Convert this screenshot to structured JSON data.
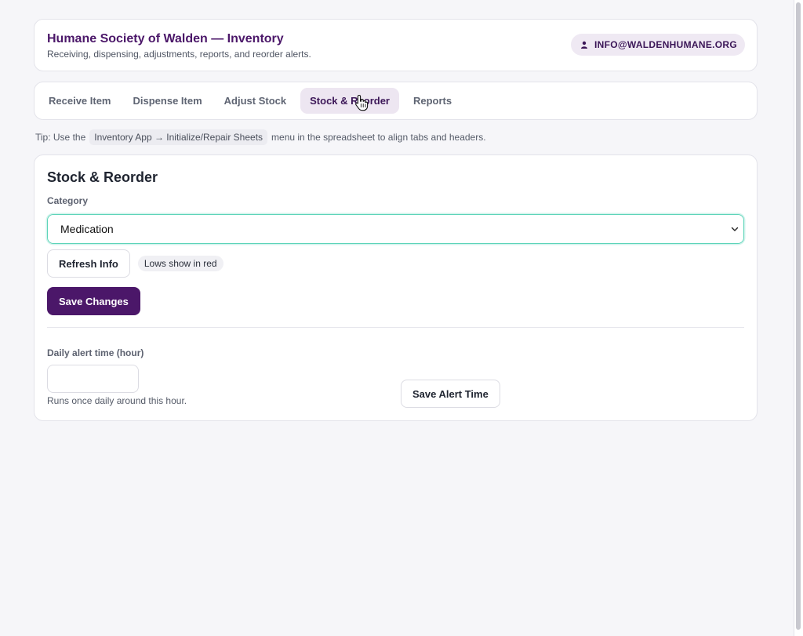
{
  "header": {
    "title": "Humane Society of Walden — Inventory",
    "subtitle": "Receiving, dispensing, adjustments, reports, and reorder alerts.",
    "user_email": "INFO@WALDENHUMANE.ORG",
    "user_icon": "user-icon"
  },
  "tabs": [
    {
      "label": "Receive Item",
      "active": false
    },
    {
      "label": "Dispense Item",
      "active": false
    },
    {
      "label": "Adjust Stock",
      "active": false
    },
    {
      "label": "Stock & Reorder",
      "active": true
    },
    {
      "label": "Reports",
      "active": false
    }
  ],
  "tip": {
    "prefix": "Tip: Use the",
    "code": "Inventory App → Initialize/Repair Sheets",
    "suffix": "menu in the spreadsheet to align tabs and headers."
  },
  "stock": {
    "title": "Stock & Reorder",
    "category_label": "Category",
    "category_value": "Medication",
    "refresh_label": "Refresh Info",
    "lows_note": "Lows show in red",
    "save_label": "Save Changes",
    "alert_label": "Daily alert time (hour)",
    "alert_value": "",
    "alert_hint": "Runs once daily around this hour.",
    "save_alert_label": "Save Alert Time"
  },
  "colors": {
    "brand": "#4b1769",
    "focus_ring": "#5dd4b9",
    "page_bg": "#f6f6f9"
  }
}
